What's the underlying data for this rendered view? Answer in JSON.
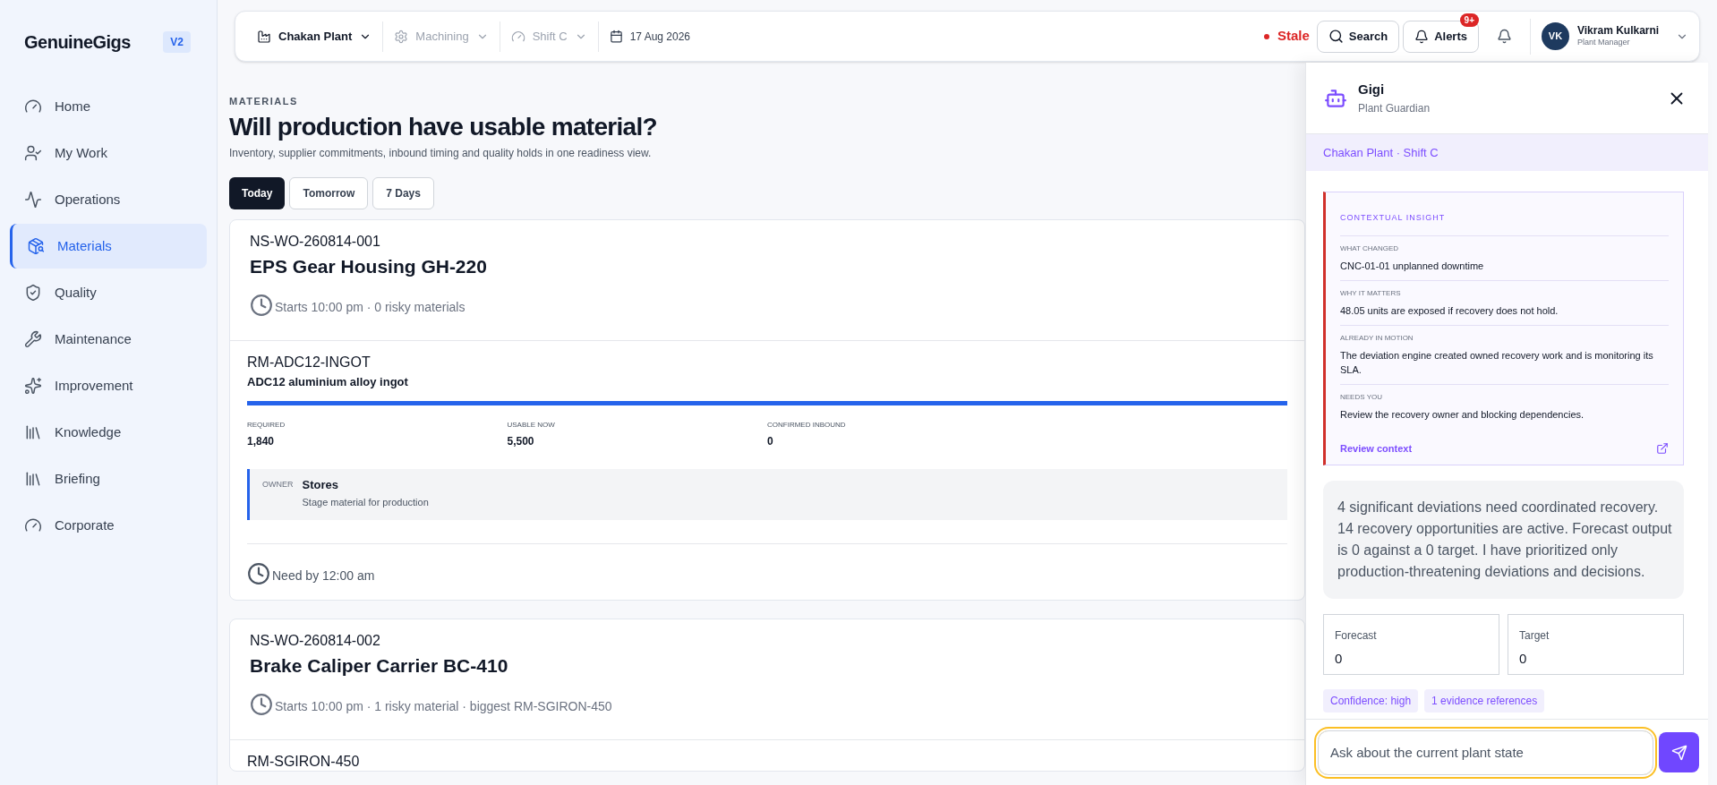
{
  "sidebar": {
    "brand": "GenuineGigs",
    "version": "V2",
    "items": [
      {
        "label": "Home",
        "selected": false
      },
      {
        "label": "My Work",
        "selected": false
      },
      {
        "label": "Operations",
        "selected": false
      },
      {
        "label": "Materials",
        "selected": true
      },
      {
        "label": "Quality",
        "selected": false
      },
      {
        "label": "Maintenance",
        "selected": false
      },
      {
        "label": "Improvement",
        "selected": false
      },
      {
        "label": "Knowledge",
        "selected": false
      },
      {
        "label": "Briefing",
        "selected": false
      },
      {
        "label": "Corporate",
        "selected": false
      }
    ]
  },
  "topbar": {
    "filters": [
      {
        "label": "Chakan Plant",
        "disabled": false
      },
      {
        "label": "Machining",
        "disabled": true
      },
      {
        "label": "Shift C",
        "disabled": true
      }
    ],
    "date": "17 Aug 2026",
    "status": "Stale",
    "search": "Search",
    "alerts": "Alerts",
    "alerts_badge": "9+",
    "user": {
      "initials": "VK",
      "name": "Vikram Kulkarni",
      "role": "Plant Manager"
    }
  },
  "page": {
    "eyebrow": "MATERIALS",
    "title": "Will production have usable material?",
    "subtitle": "Inventory, supplier commitments, inbound timing and quality holds in one readiness view.",
    "tabs": [
      {
        "label": "Today",
        "selected": true
      },
      {
        "label": "Tomorrow",
        "selected": false
      },
      {
        "label": "7 Days",
        "selected": false
      }
    ],
    "orders": [
      {
        "id": "NS-WO-260814-001",
        "title": "EPS Gear Housing GH-220",
        "meta": "Starts 10:00 pm · 0 risky materials",
        "materials": [
          {
            "code": "RM-ADC12-INGOT",
            "name": "ADC12 aluminium alloy ingot",
            "bar": true,
            "stats": [
              {
                "label": "REQUIRED",
                "value": "1,840"
              },
              {
                "label": "USABLE NOW",
                "value": "5,500"
              },
              {
                "label": "CONFIRMED INBOUND",
                "value": "0"
              }
            ],
            "owner": {
              "label": "OWNER",
              "name": "Stores",
              "action": "Stage material for production"
            },
            "need_by": "Need by 12:00 am"
          }
        ]
      },
      {
        "id": "NS-WO-260814-002",
        "title": "Brake Caliper Carrier BC-410",
        "meta": "Starts 10:00 pm · 1 risky material · biggest RM-SGIRON-450",
        "materials": [
          {
            "code": "RM-SGIRON-450"
          }
        ]
      }
    ]
  },
  "assistant": {
    "name": "Gigi",
    "role": "Plant Guardian",
    "context": "Chakan Plant · Shift C",
    "insight": {
      "heading": "CONTEXTUAL INSIGHT",
      "sections": [
        {
          "label": "WHAT CHANGED",
          "text": "CNC-01-01 unplanned downtime"
        },
        {
          "label": "WHY IT MATTERS",
          "text": "48.05 units are exposed if recovery does not hold."
        },
        {
          "label": "ALREADY IN MOTION",
          "text": "The deviation engine created owned recovery work and is monitoring its SLA."
        },
        {
          "label": "NEEDS YOU",
          "text": "Review the recovery owner and blocking dependencies."
        }
      ],
      "link": "Review context"
    },
    "summary": "4 significant deviations need coordinated recovery. 14 recovery opportunities are active. Forecast output is 0 against a 0 target. I have prioritized only production-threatening deviations and decisions.",
    "stats": [
      {
        "label": "Forecast",
        "value": "0"
      },
      {
        "label": "Target",
        "value": "0"
      }
    ],
    "chips": [
      "Confidence: high",
      "1 evidence references"
    ],
    "input": {
      "placeholder": "Ask about the current plant state"
    }
  }
}
